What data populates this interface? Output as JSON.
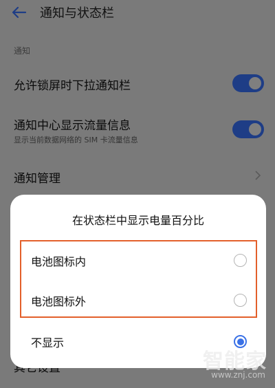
{
  "header": {
    "title": "通知与状态栏"
  },
  "section": {
    "notification_header": "通知"
  },
  "settings": [
    {
      "label": "允许锁屏时下拉通知栏",
      "subtitle": "",
      "toggle_on": true
    },
    {
      "label": "通知中心显示流量信息",
      "subtitle": "显示当前数据网络的 SIM 卡流量信息",
      "toggle_on": true
    },
    {
      "label": "通知管理"
    }
  ],
  "bottom_row": {
    "label": "其它设置"
  },
  "dialog": {
    "title": "在状态栏中显示电量百分比",
    "options": [
      {
        "label": "电池图标内",
        "selected": false
      },
      {
        "label": "电池图标外",
        "selected": false
      },
      {
        "label": "不显示",
        "selected": true
      }
    ]
  },
  "colors": {
    "accent": "#3a71e6",
    "highlight": "#e35f2a",
    "toggle": "#1e3d86"
  },
  "watermark": {
    "logo": "智能家",
    "url": "www.znj.com"
  }
}
